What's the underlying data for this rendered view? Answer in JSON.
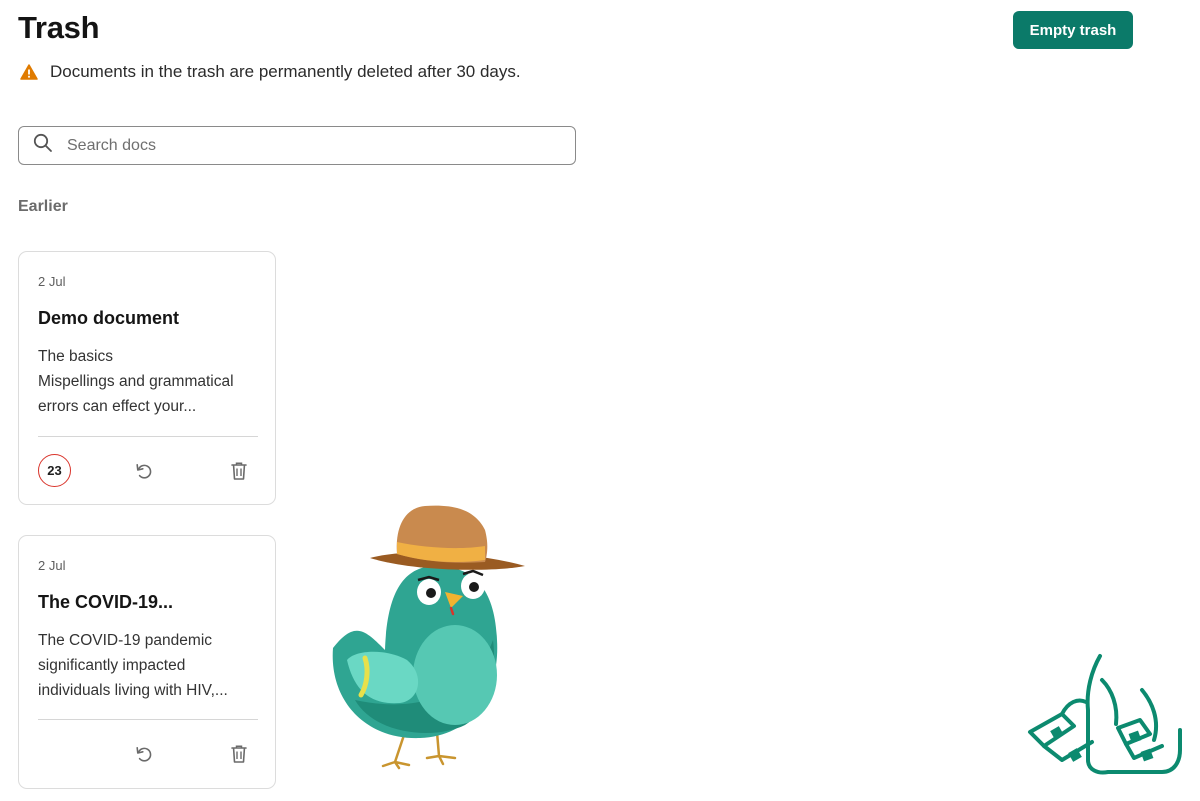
{
  "header": {
    "title": "Trash",
    "empty_label": "Empty trash"
  },
  "notice": {
    "text": "Documents in the trash are permanently deleted after 30 days.",
    "icon": "warning-icon",
    "color": "#e07b00"
  },
  "search": {
    "placeholder": "Search docs",
    "value": ""
  },
  "section": {
    "label": "Earlier"
  },
  "cards": [
    {
      "date": "2 Jul",
      "title": "Demo document",
      "snippet_lines": [
        "The basics",
        "Mispellings and grammatical",
        "errors can effect your..."
      ],
      "badge": "23"
    },
    {
      "date": "2 Jul",
      "title": "The COVID-19...",
      "snippet_lines": [
        "The COVID-19 pandemic",
        "significantly impacted",
        "individuals living with HIV,..."
      ]
    }
  ],
  "colors": {
    "accent": "#0b7a69",
    "badge_border": "#d9342b",
    "bird": "#2fa592"
  }
}
